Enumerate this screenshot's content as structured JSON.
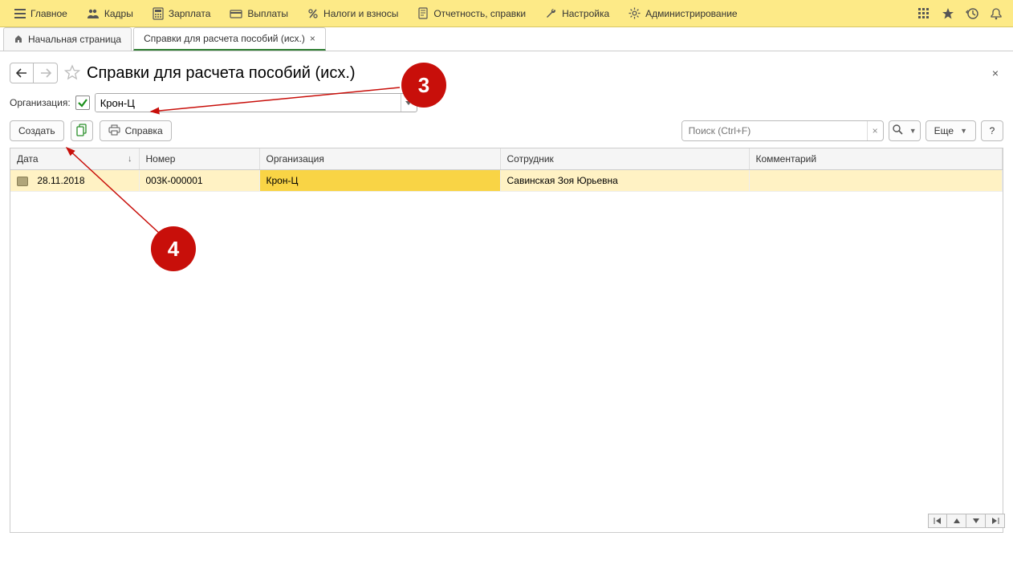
{
  "topmenu": {
    "items": [
      {
        "label": "Главное"
      },
      {
        "label": "Кадры"
      },
      {
        "label": "Зарплата"
      },
      {
        "label": "Выплаты"
      },
      {
        "label": "Налоги и взносы"
      },
      {
        "label": "Отчетность, справки"
      },
      {
        "label": "Настройка"
      },
      {
        "label": "Администрирование"
      }
    ]
  },
  "tabs": {
    "home_label": "Начальная страница",
    "active_label": "Справки для расчета пособий (исх.)"
  },
  "page": {
    "title": "Справки для расчета пособий (исх.)"
  },
  "filter": {
    "label": "Организация:",
    "value": "Крон-Ц"
  },
  "toolbar": {
    "create_label": "Создать",
    "print_label": "Справка",
    "search_placeholder": "Поиск (Ctrl+F)",
    "more_label": "Еще",
    "help_label": "?"
  },
  "table": {
    "columns": {
      "date": "Дата",
      "number": "Номер",
      "org": "Организация",
      "employee": "Сотрудник",
      "comment": "Комментарий"
    },
    "rows": [
      {
        "date": "28.11.2018",
        "number": "003К-000001",
        "org": "Крон-Ц",
        "employee": "Савинская Зоя Юрьевна",
        "comment": ""
      }
    ]
  },
  "annotations": {
    "badge3": "3",
    "badge4": "4"
  }
}
